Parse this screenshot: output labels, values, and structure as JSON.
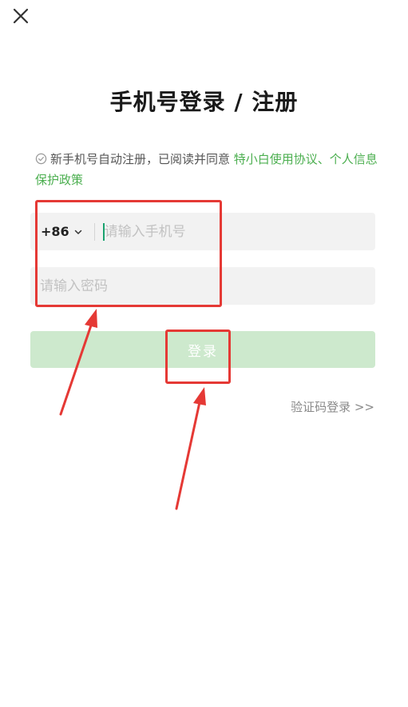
{
  "icons": {
    "close": "close-icon",
    "check": "check-circle-icon",
    "dropdown": "chevron-down-icon"
  },
  "header": {
    "title": "手机号登录 / 注册"
  },
  "agreement": {
    "text": "新手机号自动注册，已阅读并同意 ",
    "link": "特小白使用协议、个人信息保护政策"
  },
  "phone": {
    "country_code": "+86",
    "placeholder": "请输入手机号",
    "value": ""
  },
  "password": {
    "placeholder": "请输入密码",
    "value": ""
  },
  "login_button": {
    "label": "登录"
  },
  "alt_login": {
    "label": "验证码登录 >>"
  },
  "colors": {
    "accent": "#4caf50",
    "button_disabled": "#cde9cd",
    "input_bg": "#f2f2f2",
    "annotation": "#e53935"
  }
}
